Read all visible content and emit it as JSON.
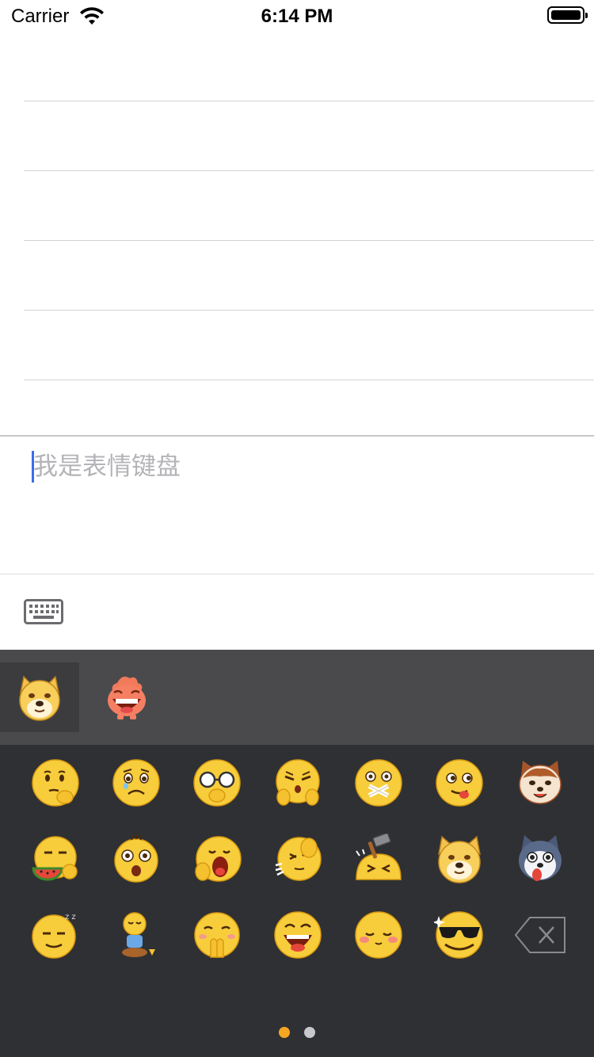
{
  "status_bar": {
    "carrier": "Carrier",
    "time": "6:14 PM",
    "battery_level": 1.0
  },
  "list": {
    "row_count": 5
  },
  "input": {
    "placeholder": "我是表情键盘"
  },
  "toolbar": {
    "keyboard_toggle_icon": "keyboard-icon"
  },
  "emoji_keyboard": {
    "packs": [
      {
        "name": "doge-pack-icon",
        "selected": true
      },
      {
        "name": "laughing-monster-pack-icon",
        "selected": false
      }
    ],
    "emojis": [
      "think",
      "aggrieved",
      "shy-glasses",
      "angry-face",
      "sealed-lips",
      "tongue-out",
      "cat",
      "eat-melon",
      "shocked",
      "yawn",
      "slap",
      "hammer",
      "doge",
      "husky",
      "sleepy",
      "sit-down",
      "pray",
      "big-laugh",
      "blush",
      "sunglasses"
    ],
    "delete_icon": "backspace-icon",
    "page_count": 2,
    "current_page": 1,
    "colors": {
      "tab_bar": "#4a4a4c",
      "grid_bg": "#2f3033",
      "page_dot_active": "#f5a623",
      "page_dot": "#c8c8cc"
    }
  }
}
